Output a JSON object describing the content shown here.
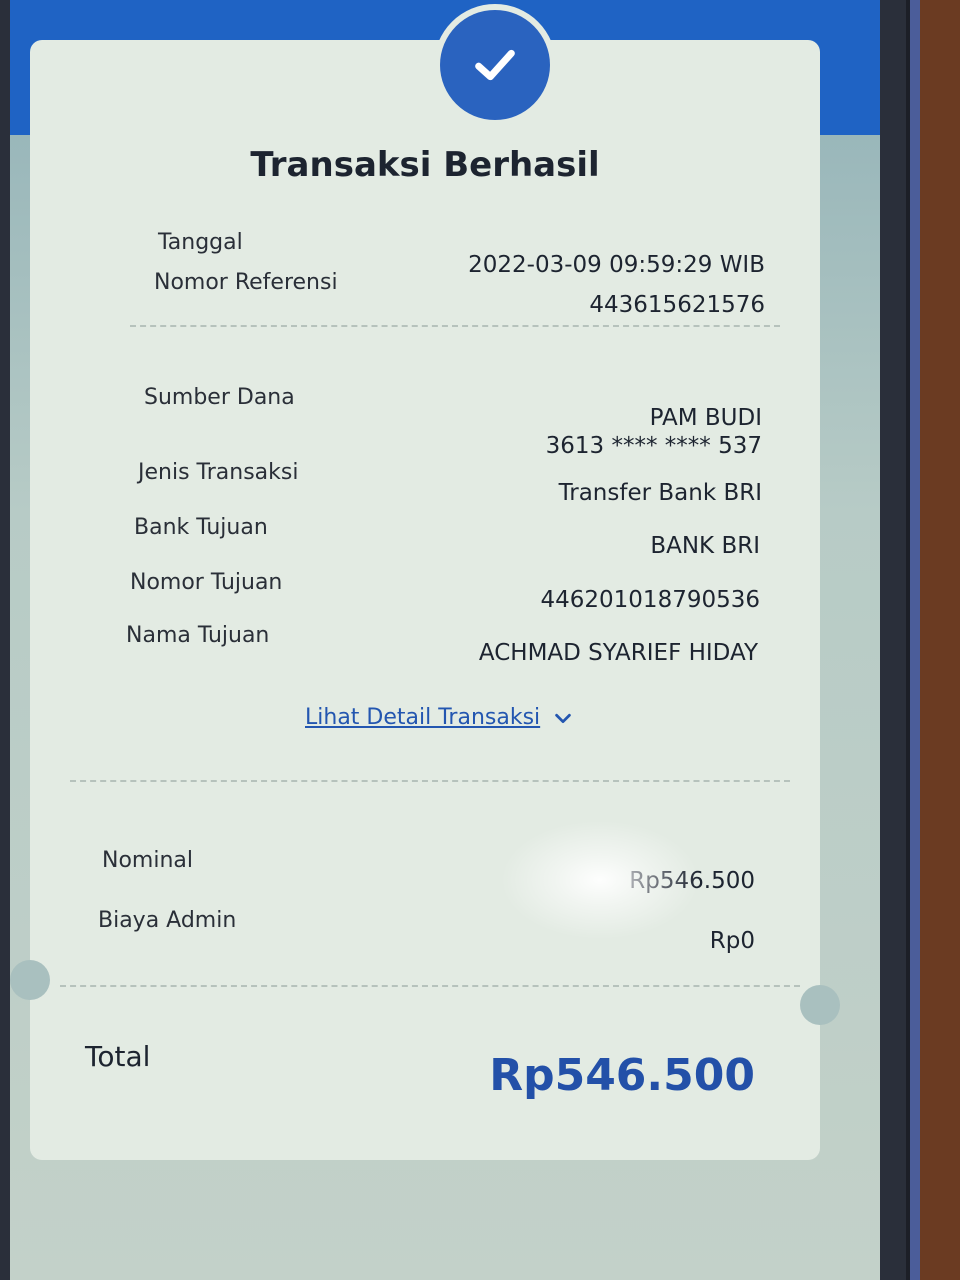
{
  "receipt": {
    "title": "Transaksi Berhasil",
    "rows_top": [
      {
        "label": "Tanggal",
        "value": "2022-03-09 09:59:29 WIB"
      },
      {
        "label": "Nomor Referensi",
        "value": "443615621576"
      }
    ],
    "sumber_dana": {
      "label": "Sumber Dana",
      "name": "PAM BUDI",
      "account": "3613 **** **** 537"
    },
    "rows_mid": [
      {
        "label": "Jenis Transaksi",
        "value": "Transfer Bank BRI"
      },
      {
        "label": "Bank Tujuan",
        "value": "BANK BRI"
      },
      {
        "label": "Nomor Tujuan",
        "value": "446201018790536"
      },
      {
        "label": "Nama Tujuan",
        "value": "ACHMAD SYARIEF HIDAY"
      }
    ],
    "detail_link": "Lihat Detail Transaksi",
    "rows_bottom": [
      {
        "label": "Nominal",
        "value": "Rp546.500"
      },
      {
        "label": "Biaya Admin",
        "value": "Rp0"
      }
    ],
    "total": {
      "label": "Total",
      "value": "Rp546.500"
    }
  },
  "icons": {
    "success": "check-icon",
    "expand": "chevron-down-icon"
  },
  "colors": {
    "header": "#1f63c4",
    "accent": "#2350a8",
    "link": "#2356b0"
  }
}
